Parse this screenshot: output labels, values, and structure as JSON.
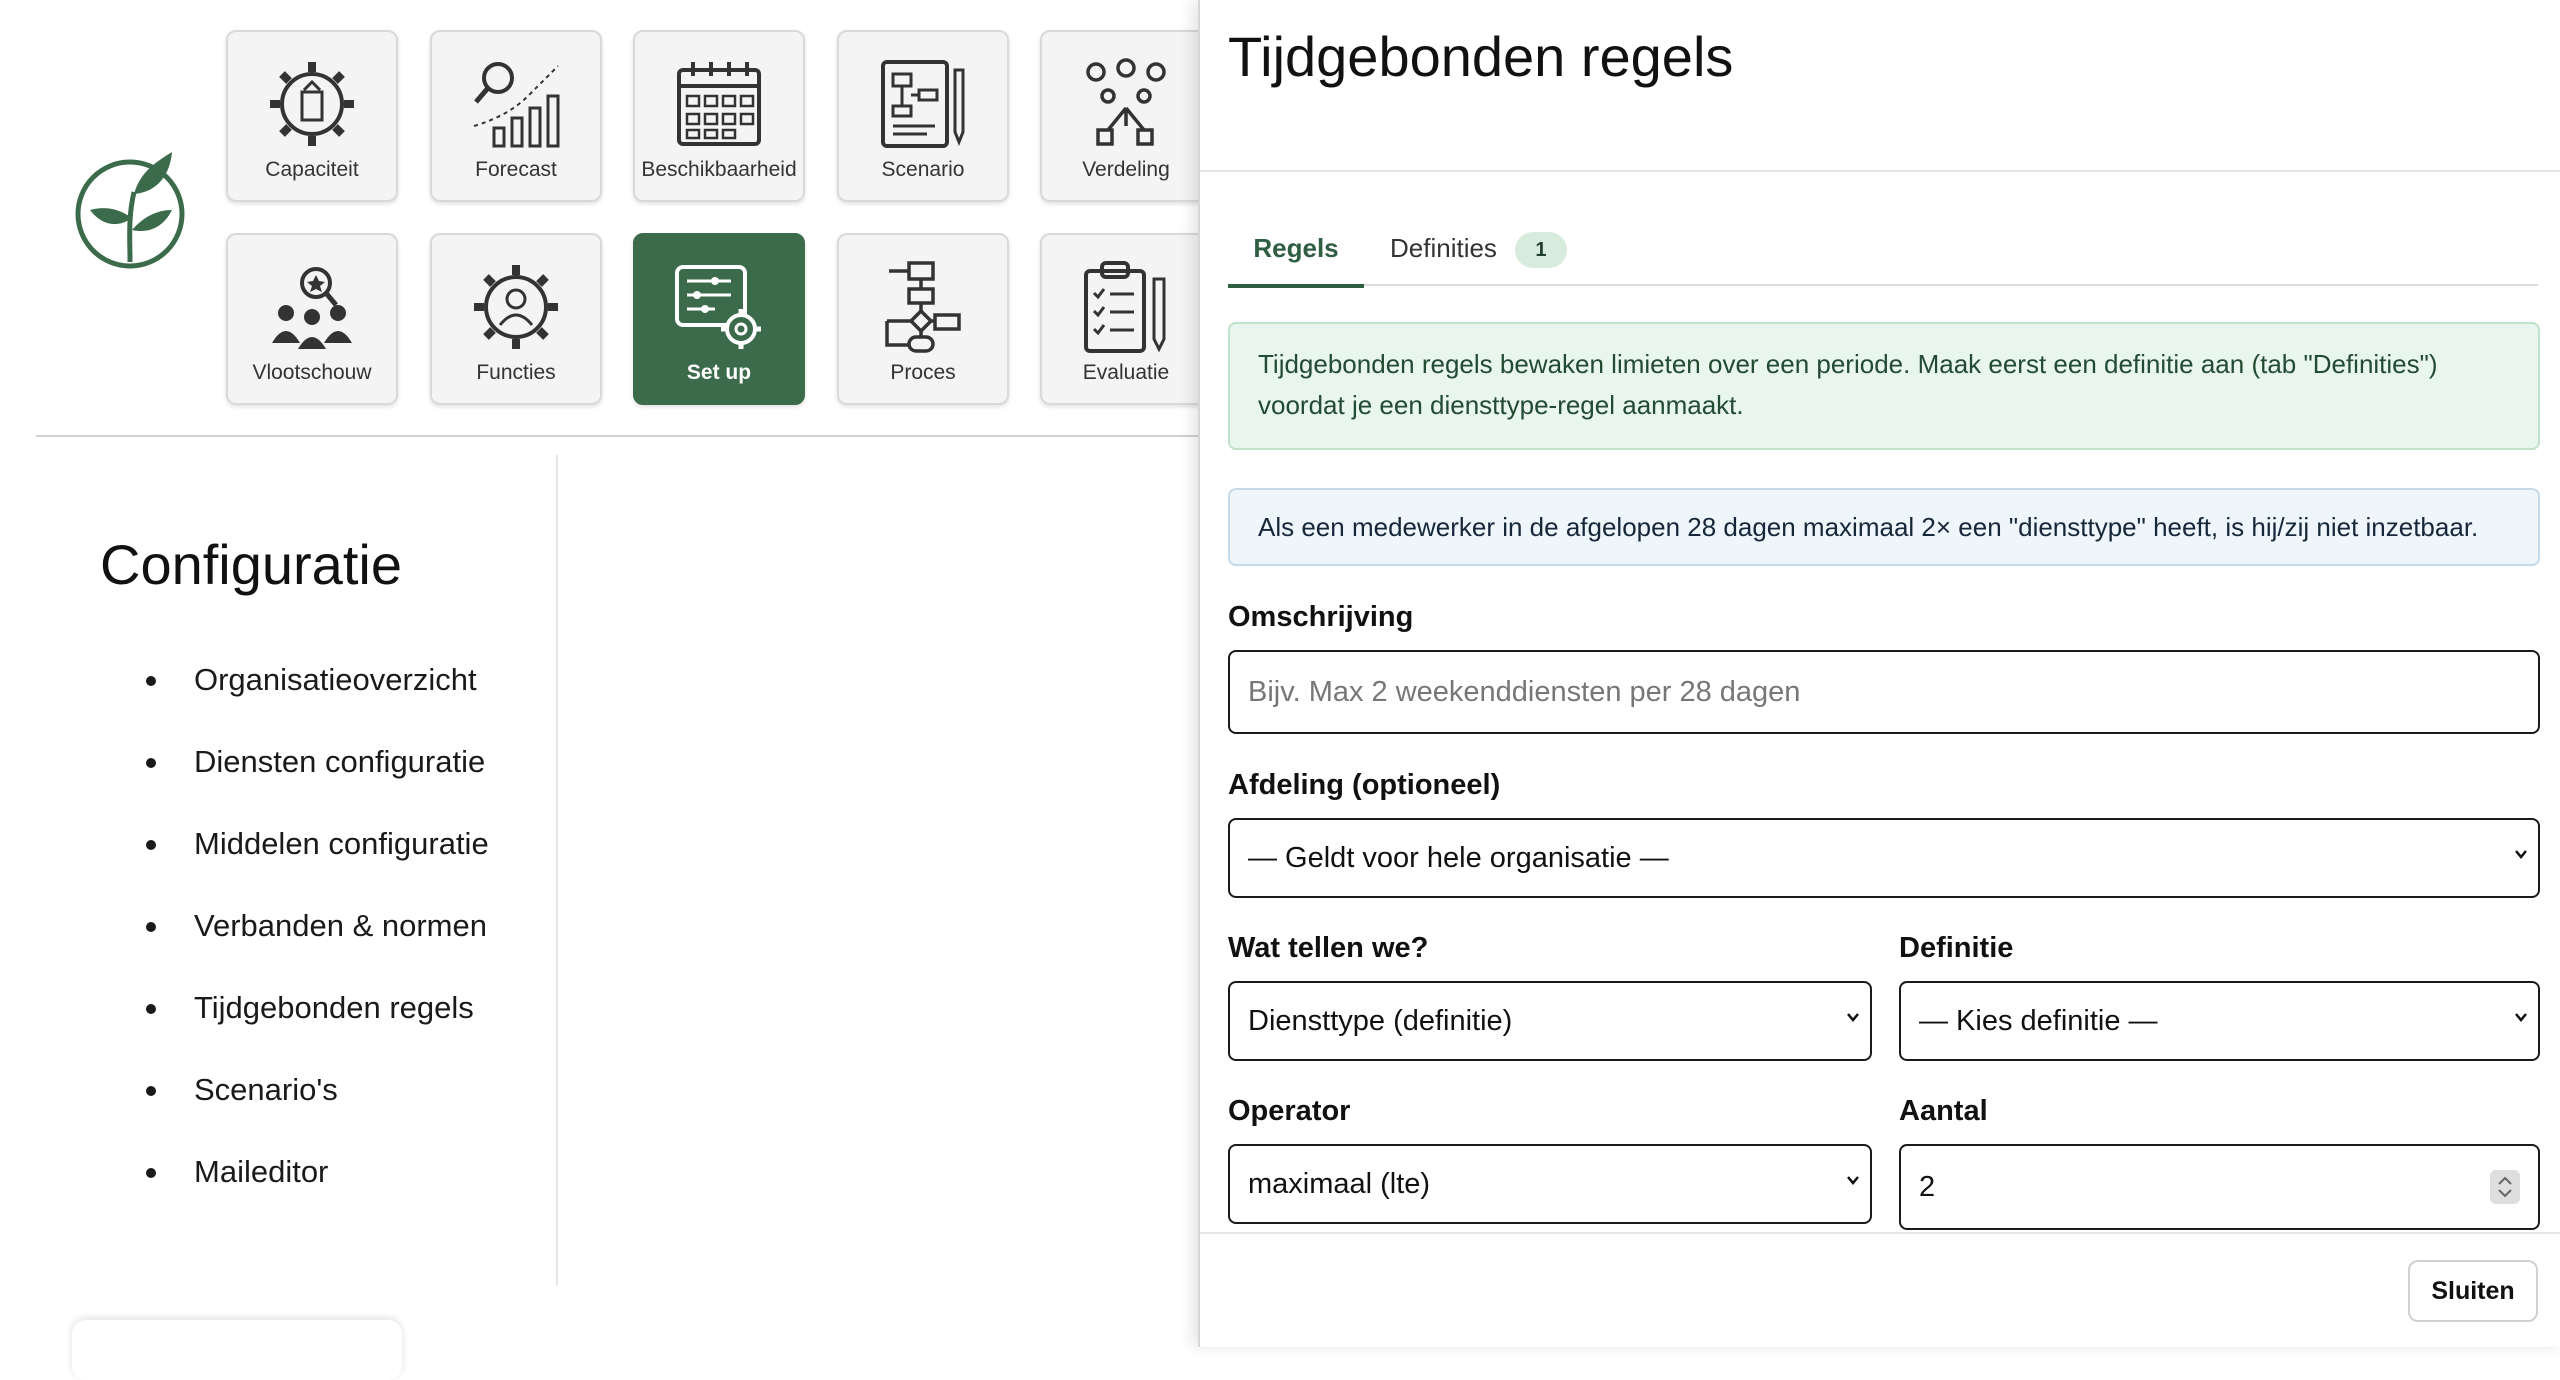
{
  "nav": {
    "tiles": [
      {
        "label": "Capaciteit",
        "icon": "gear-capacity-icon"
      },
      {
        "label": "Forecast",
        "icon": "forecast-chart-icon"
      },
      {
        "label": "Beschikbaarheid",
        "icon": "calendar-icon"
      },
      {
        "label": "Scenario",
        "icon": "scenario-document-icon"
      },
      {
        "label": "Verdeling",
        "icon": "distribution-icon"
      },
      {
        "label": "Vlootschouw",
        "icon": "team-review-icon"
      },
      {
        "label": "Functies",
        "icon": "gear-person-icon"
      },
      {
        "label": "Set up",
        "icon": "setup-sliders-icon",
        "active": true
      },
      {
        "label": "Proces",
        "icon": "process-flow-icon"
      },
      {
        "label": "Evaluatie",
        "icon": "clipboard-checklist-icon"
      }
    ]
  },
  "config": {
    "title": "Configuratie",
    "items": [
      "Organisatieoverzicht",
      "Diensten configuratie",
      "Middelen configuratie",
      "Verbanden & normen",
      "Tijdgebonden regels",
      "Scenario's",
      "Maileditor"
    ]
  },
  "panel": {
    "title": "Tijdgebonden regels",
    "tabs": {
      "rules": "Regels",
      "definitions": "Definities",
      "definitions_count": "1"
    },
    "success_text": "Tijdgebonden regels bewaken limieten over een periode. Maak eerst een definitie aan (tab \"Definities\") voordat je een diensttype-regel aanmaakt.",
    "info_text": "Als een medewerker in de afgelopen 28 dagen maximaal 2× een \"diensttype\" heeft, is hij/zij niet inzetbaar.",
    "description_label": "Omschrijving",
    "description_placeholder": "Bijv. Max 2 weekenddiensten per 28 dagen",
    "department_label": "Afdeling (optioneel)",
    "department_value": "— Geldt voor hele organisatie —",
    "count_label": "Wat tellen we?",
    "count_value": "Diensttype (definitie)",
    "definition_label": "Definitie",
    "definition_value": "— Kies definitie —",
    "operator_label": "Operator",
    "operator_value": "maximaal (lte)",
    "amount_label": "Aantal",
    "amount_value": "2",
    "close_label": "Sluiten"
  },
  "colors": {
    "brand_green": "#3c6b4c",
    "tab_active": "#2f5e43",
    "success_bg": "#e9f6ee",
    "info_bg": "#eef5fb"
  }
}
